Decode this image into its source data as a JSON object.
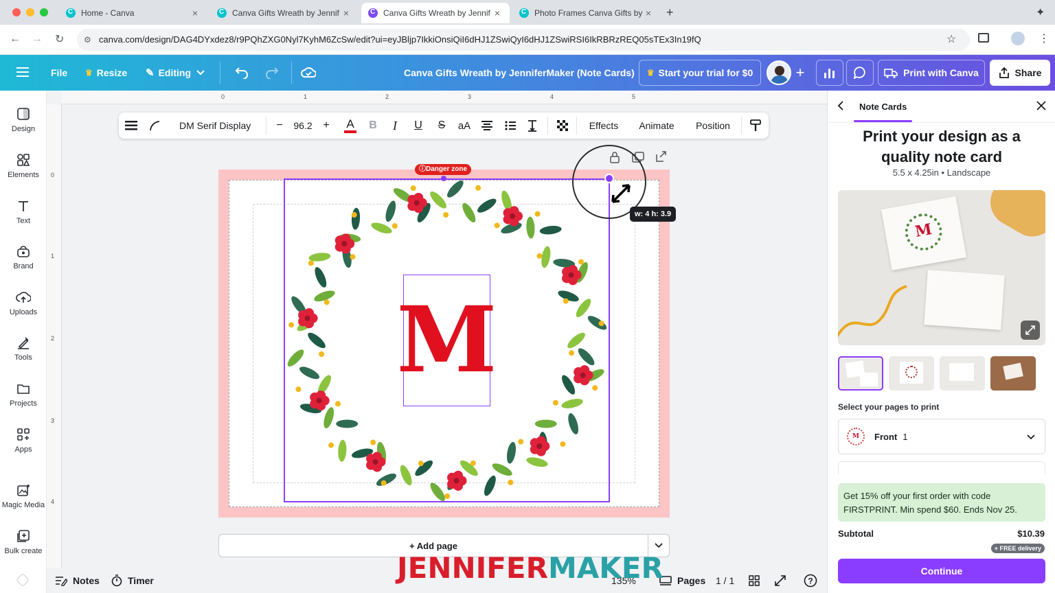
{
  "browser": {
    "tabs": [
      {
        "title": "Home - Canva"
      },
      {
        "title": "Canva Gifts Wreath by Jennif"
      },
      {
        "title": "Canva Gifts Wreath by Jennif"
      },
      {
        "title": "Photo Frames Canva Gifts by"
      }
    ],
    "url": "canva.com/design/DAG4DYxdez8/r9PQhZXG0Nyl7KyhM6ZcSw/edit?ui=eyJBljp7IkkiOnsiQiI6dHJ1ZSwiQyI6dHJ1ZSwiRSI6IkRBRzREQ05sTEx3In19fQ"
  },
  "header": {
    "file": "File",
    "resize": "Resize",
    "editing": "Editing",
    "doc_title": "Canva Gifts Wreath by JenniferMaker (Note Cards)",
    "trial": "Start your trial for $0",
    "print": "Print with Canva",
    "share": "Share"
  },
  "rail": [
    {
      "label": "Design",
      "icon": "design-icon"
    },
    {
      "label": "Elements",
      "icon": "elements-icon"
    },
    {
      "label": "Text",
      "icon": "text-icon"
    },
    {
      "label": "Brand",
      "icon": "brand-icon"
    },
    {
      "label": "Uploads",
      "icon": "uploads-icon"
    },
    {
      "label": "Tools",
      "icon": "tools-icon"
    },
    {
      "label": "Projects",
      "icon": "projects-icon"
    },
    {
      "label": "Apps",
      "icon": "apps-icon"
    },
    {
      "label": "Magic Media",
      "icon": "magic-media-icon"
    },
    {
      "label": "Bulk create",
      "icon": "bulk-create-icon"
    }
  ],
  "ruler": {
    "top": [
      "0",
      "1",
      "2",
      "3",
      "4",
      "5"
    ],
    "left": [
      "0",
      "1",
      "2",
      "3",
      "4"
    ]
  },
  "toolbar": {
    "font": "DM Serif Display",
    "size": "96.2",
    "case": "aA",
    "effects": "Effects",
    "animate": "Animate",
    "position": "Position"
  },
  "canvas": {
    "danger_zone": "Danger zone",
    "dimensions": "w: 4 h: 3.9",
    "monogram": "M",
    "add_page": "+ Add page"
  },
  "footer": {
    "notes": "Notes",
    "timer": "Timer",
    "zoom": "135%",
    "pages": "Pages",
    "page_count": "1 / 1"
  },
  "logo": {
    "part1": "JENNIFER",
    "part2": "MAKER"
  },
  "panel": {
    "tab": "Note Cards",
    "title": "Print your design as a quality note card",
    "subtitle": "5.5 x 4.25in • Landscape",
    "mock_letter": "M",
    "select_label": "Select your pages to print",
    "select_value": "Front",
    "select_count": "1",
    "promo": "Get 15% off your first order with code FIRSTPRINT. Min spend $60. Ends Nov 25.",
    "subtotal_label": "Subtotal",
    "subtotal_value": "$10.39",
    "free_delivery": "+ FREE delivery",
    "continue": "Continue"
  },
  "colors": {
    "accent": "#8b3dff",
    "monogram_red": "#e0101e",
    "bleed_pink": "#fcc4c4",
    "logo_red": "#d91e2b",
    "logo_teal": "#2aa1a6"
  }
}
